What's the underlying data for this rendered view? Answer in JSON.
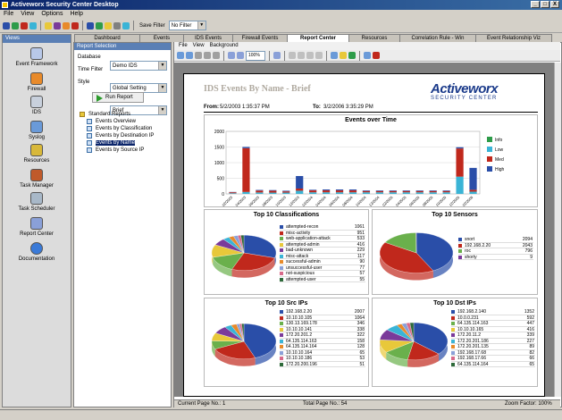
{
  "window": {
    "title": "Activeworx Security Center Desktop",
    "controls": [
      "_",
      "□",
      "X"
    ]
  },
  "menubar": [
    "File",
    "View",
    "Options",
    "Help"
  ],
  "toolbar": {
    "save_filter_label": "Save Filter",
    "filter_value": "No Filter"
  },
  "main_tabs": [
    {
      "label": "Dashboard",
      "active": false
    },
    {
      "label": "Events",
      "active": false
    },
    {
      "label": "IDS Events",
      "active": false
    },
    {
      "label": "Firewall Events",
      "active": false
    },
    {
      "label": "Report Center",
      "active": true
    },
    {
      "label": "Resources",
      "active": false
    },
    {
      "label": "Correlation Rule - Win",
      "active": false
    },
    {
      "label": "Event Relationship Viz",
      "active": false
    }
  ],
  "sidebar": {
    "header": "Views",
    "items": [
      {
        "label": "Event Framework",
        "icon": "event-framework-icon"
      },
      {
        "label": "Firewall",
        "icon": "firewall-icon"
      },
      {
        "label": "IDS",
        "icon": "ids-icon"
      },
      {
        "label": "Syslog",
        "icon": "syslog-icon"
      },
      {
        "label": "Resources",
        "icon": "resources-icon"
      },
      {
        "label": "Task Manager",
        "icon": "task-manager-icon"
      },
      {
        "label": "Task Scheduler",
        "icon": "task-scheduler-icon"
      },
      {
        "label": "Report Center",
        "icon": "report-center-icon"
      },
      {
        "label": "Documentation",
        "icon": "documentation-icon"
      }
    ]
  },
  "report_panel": {
    "header": "Report Selection",
    "database_label": "Database",
    "database_value": "Demo IDS",
    "time_filter_label": "Time Filter",
    "time_filter_value": "Global Setting",
    "style_label": "Style",
    "style_value": "Brief",
    "run_label": "Run Report",
    "tree": [
      {
        "label": "Standard Reports",
        "selected": false,
        "root": true
      },
      {
        "label": "Events Overview",
        "selected": false
      },
      {
        "label": "Events by Classification",
        "selected": false
      },
      {
        "label": "Events by Destination IP",
        "selected": false
      },
      {
        "label": "Events by Name",
        "selected": true
      },
      {
        "label": "Events by Source IP",
        "selected": false
      }
    ]
  },
  "report_menu": [
    "File",
    "View",
    "Background"
  ],
  "report_toolbar": {
    "zoom": "100%"
  },
  "report": {
    "title": "IDS Events By Name - Brief",
    "logo_main": "Activeworx",
    "logo_sub": "SECURITY CENTER",
    "from_label": "From:",
    "from_value": "5/2/2003 1:35:37 PM",
    "to_label": "To:",
    "to_value": "3/2/2006 3:35:29 PM"
  },
  "status": {
    "current_page": "Current Page No.: 1",
    "total_pages": "Total Page No.: 54",
    "zoom_factor": "Zoom Factor: 100%"
  },
  "colors": {
    "info": "#2e9c4a",
    "low": "#3ab4d6",
    "med": "#c0281c",
    "high": "#2a4ea8"
  },
  "chart_data": [
    {
      "type": "bar",
      "title": "Events over Time",
      "ylim": [
        0,
        2000
      ],
      "yticks": [
        0,
        500,
        1000,
        1500,
        2000
      ],
      "categories": [
        "02/2003",
        "04/2003",
        "06/2003",
        "08/2003",
        "10/2003",
        "12/2003",
        "02/2004",
        "04/2004",
        "06/2004",
        "08/2004",
        "10/2004",
        "12/2004",
        "02/2005",
        "04/2005",
        "06/2005",
        "08/2005",
        "10/2005",
        "12/2005",
        "02/2006"
      ],
      "stacked": true,
      "series": [
        {
          "name": "Info",
          "color": "#2e9c4a",
          "values": [
            2,
            2,
            2,
            2,
            2,
            2,
            2,
            2,
            2,
            2,
            2,
            2,
            2,
            2,
            2,
            2,
            2,
            2,
            2
          ]
        },
        {
          "name": "Low",
          "color": "#3ab4d6",
          "values": [
            20,
            60,
            45,
            40,
            40,
            100,
            50,
            50,
            50,
            50,
            50,
            50,
            50,
            50,
            50,
            50,
            50,
            550,
            70
          ]
        },
        {
          "name": "Med",
          "color": "#c0281c",
          "values": [
            30,
            1400,
            60,
            60,
            40,
            70,
            60,
            60,
            60,
            60,
            40,
            40,
            40,
            40,
            40,
            40,
            40,
            900,
            60
          ]
        },
        {
          "name": "High",
          "color": "#2a4ea8",
          "values": [
            10,
            40,
            20,
            20,
            20,
            400,
            20,
            30,
            30,
            30,
            20,
            20,
            20,
            20,
            20,
            20,
            20,
            40,
            700
          ]
        }
      ],
      "legend": "right"
    },
    {
      "type": "pie",
      "title": "Top 10 Classifications",
      "labels": [
        "attempted-recon",
        "misc-activity",
        "web-application-attack",
        "attempted-admin",
        "bad-unknown",
        "misc-attack",
        "successful-admin",
        "unsuccessful-user",
        "not-suspicious",
        "attempted-user"
      ],
      "values": [
        1061,
        951,
        533,
        416,
        229,
        117,
        90,
        77,
        57,
        55
      ],
      "colors": [
        "#2a4ea8",
        "#c0281c",
        "#6ab04c",
        "#e8c83a",
        "#7a3a9a",
        "#3ab4d6",
        "#e88a2a",
        "#8aa0d8",
        "#d86a8a",
        "#2e6a3a"
      ]
    },
    {
      "type": "pie",
      "title": "Top 10 Sensors",
      "labels": [
        "snort",
        "192.168.2.20",
        "roc",
        "shorty"
      ],
      "values": [
        2094,
        2043,
        796,
        9
      ],
      "colors": [
        "#2a4ea8",
        "#c0281c",
        "#6ab04c",
        "#7a3a9a"
      ]
    },
    {
      "type": "pie",
      "title": "Top 10 Src IPs",
      "labels": [
        "192.168.2.20",
        "10.10.10.105",
        "130.13.169.178",
        "10.10.10.141",
        "172.20.201.2",
        "64.135.114.163",
        "64.135.114.164",
        "10.10.10.164",
        "10.10.10.186",
        "172.20.200.196"
      ],
      "values": [
        2007,
        1064,
        346,
        338,
        322,
        158,
        128,
        65,
        53,
        51
      ],
      "colors": [
        "#2a4ea8",
        "#c0281c",
        "#6ab04c",
        "#e8c83a",
        "#7a3a9a",
        "#3ab4d6",
        "#e88a2a",
        "#8aa0d8",
        "#d86a8a",
        "#2e6a3a"
      ]
    },
    {
      "type": "pie",
      "title": "Top 10 Dst IPs",
      "labels": [
        "192.168.2.140",
        "10.0.0.231",
        "64.135.114.163",
        "10.10.10.165",
        "172.20.11.2",
        "172.20.201.186",
        "172.20.201.135",
        "192.168.17.68",
        "192.168.17.66",
        "64.135.114.164"
      ],
      "values": [
        1352,
        592,
        447,
        416,
        339,
        227,
        89,
        82,
        66,
        65
      ],
      "colors": [
        "#2a4ea8",
        "#c0281c",
        "#6ab04c",
        "#e8c83a",
        "#7a3a9a",
        "#3ab4d6",
        "#e88a2a",
        "#8aa0d8",
        "#d86a8a",
        "#2e6a3a"
      ]
    }
  ]
}
